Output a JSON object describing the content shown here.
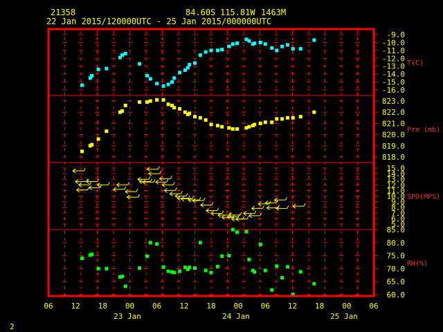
{
  "header": {
    "station": "21358",
    "lat": "84.60S",
    "lon": "115.81W",
    "elev": "1463M",
    "range": "22 Jan 2015/120000UTC - 25 Jan 2015/000000UTC"
  },
  "footer": {
    "page_num": "2"
  },
  "colors": {
    "frame": "#ff0000",
    "text": "#ffff00",
    "temp": "#00ffff",
    "pres": "#ffff00",
    "wind": "#ffff00",
    "rh": "#00ff00"
  },
  "x_axis": {
    "hour_labels": [
      "06",
      "12",
      "18",
      "00",
      "06",
      "12",
      "18",
      "00",
      "06",
      "12",
      "18",
      "00",
      "06"
    ],
    "day_labels": [
      "23 Jan",
      "24 Jan",
      "25 Jan"
    ]
  },
  "chart_data": [
    {
      "type": "scatter",
      "name": "T(C)",
      "ylabel": "T(C)",
      "ylim": [
        -16,
        -9
      ],
      "ticks": [
        "-9.0",
        "-10.0",
        "-11.0",
        "-12.0",
        "-13.0",
        "-14.0",
        "-15.0",
        "-16.0"
      ],
      "x": [
        12.2,
        13.7,
        14.0,
        15.2,
        16.7,
        19.2,
        19.6,
        20.2,
        22.8,
        24.2,
        24.8,
        26.0,
        27.2,
        28.1,
        28.8,
        29.2,
        30.2,
        31.2,
        31.7,
        32.0,
        33.0,
        34.0,
        35.0,
        36.0,
        37.2,
        38.0,
        39.3,
        40.0,
        40.8,
        42.5,
        43.0,
        43.7,
        44.0,
        45.1,
        46.0,
        47.2,
        48.1,
        49.1,
        50.1,
        51.1,
        52.5,
        55.0
      ],
      "y": [
        -15.4,
        -14.5,
        -14.2,
        -13.4,
        -13.3,
        -11.9,
        -11.6,
        -11.4,
        -12.7,
        -14.2,
        -14.6,
        -15.2,
        -15.5,
        -15.3,
        -15.0,
        -14.5,
        -13.8,
        -13.5,
        -13.2,
        -12.8,
        -12.6,
        -11.6,
        -11.2,
        -11.0,
        -11.0,
        -10.9,
        -10.5,
        -10.2,
        -10.1,
        -9.6,
        -9.8,
        -10.2,
        -10.1,
        -10.0,
        -10.2,
        -10.7,
        -11.0,
        -10.5,
        -10.3,
        -10.8,
        -10.8,
        -9.7
      ]
    },
    {
      "type": "scatter",
      "name": "Pre (mb)",
      "ylabel": "Pre (mb)",
      "ylim": [
        818,
        823
      ],
      "ticks": [
        "823.0",
        "822.0",
        "821.0",
        "820.0",
        "819.0",
        "818.0"
      ],
      "x": [
        12.2,
        13.7,
        14.0,
        15.2,
        16.7,
        19.2,
        19.6,
        20.2,
        22.8,
        24.2,
        24.8,
        26.0,
        27.2,
        28.1,
        28.8,
        29.2,
        30.2,
        31.2,
        31.7,
        32.0,
        33.0,
        34.0,
        35.0,
        36.0,
        37.2,
        38.0,
        39.3,
        40.0,
        40.8,
        42.5,
        43.0,
        43.7,
        44.0,
        45.1,
        46.0,
        47.2,
        48.1,
        49.1,
        50.1,
        51.1,
        52.5,
        55.0
      ],
      "y": [
        818.5,
        819.0,
        819.1,
        819.6,
        820.3,
        822.0,
        822.1,
        822.6,
        822.9,
        822.9,
        823.0,
        823.1,
        823.1,
        822.7,
        822.6,
        822.4,
        822.3,
        822.0,
        821.8,
        821.9,
        821.6,
        821.5,
        821.3,
        820.9,
        820.8,
        820.7,
        820.6,
        820.5,
        820.5,
        820.6,
        820.7,
        820.8,
        820.9,
        821.0,
        821.1,
        821.1,
        821.4,
        821.4,
        821.5,
        821.5,
        821.6,
        822.0
      ]
    },
    {
      "type": "barbs",
      "name": "SPD(MPS)",
      "ylabel": "SPD(MPS)",
      "ylim": [
        5,
        15
      ],
      "ticks": [
        "15.0",
        "14.0",
        "13.0",
        "12.0",
        "11.0",
        "10.0",
        "9.0",
        "8.0",
        "7.0",
        "6.0",
        "5.0"
      ],
      "x": [
        11.5,
        12.0,
        12.2,
        12.6,
        14.0,
        14.5,
        16.0,
        19.0,
        19.6,
        21.2,
        21.5,
        23.5,
        23.8,
        24.4,
        25.2,
        25.5,
        26.8,
        27.5,
        28.0,
        28.4,
        29.4,
        30.4,
        30.8,
        31.5,
        32.8,
        33.6,
        35.1,
        36.1,
        37.0,
        38.3,
        39.0,
        40.0,
        40.3,
        40.8,
        41.6,
        43.0,
        44.0,
        44.5,
        45.7,
        47.0,
        47.3,
        48.7,
        49.0,
        52.1
      ],
      "y": [
        14.5,
        12.6,
        11.1,
        12.0,
        12.6,
        11.5,
        12.0,
        11.2,
        12.0,
        10.8,
        9.8,
        13.0,
        12.6,
        12.5,
        14.8,
        14.0,
        12.5,
        13.1,
        12.0,
        11.0,
        10.4,
        10.0,
        9.6,
        9.5,
        9.3,
        9.2,
        8.4,
        7.4,
        6.9,
        6.6,
        6.2,
        6.3,
        6.6,
        5.9,
        5.9,
        6.9,
        6.5,
        7.8,
        8.6,
        8.8,
        7.9,
        9.3,
        7.8,
        8.2
      ]
    },
    {
      "type": "scatter",
      "name": "RH(%)",
      "ylabel": "RH(%)",
      "ylim": [
        60,
        85
      ],
      "ticks": [
        "85.0",
        "80.0",
        "75.0",
        "70.0",
        "65.0",
        "60.0"
      ],
      "x": [
        12.2,
        13.7,
        14.0,
        15.2,
        16.7,
        19.2,
        19.6,
        20.2,
        22.8,
        24.2,
        24.8,
        26.0,
        27.2,
        28.1,
        28.8,
        29.2,
        30.2,
        31.2,
        31.7,
        32.0,
        33.0,
        34.0,
        35.0,
        36.0,
        37.2,
        38.0,
        39.3,
        40.0,
        40.8,
        42.5,
        43.0,
        43.7,
        44.0,
        45.1,
        46.0,
        47.2,
        48.1,
        49.1,
        50.1,
        51.1,
        52.5,
        55.0
      ],
      "y": [
        74.0,
        75.2,
        75.5,
        70.0,
        70.0,
        66.8,
        67.0,
        63.2,
        70.2,
        74.8,
        80.0,
        79.5,
        70.6,
        69.0,
        68.7,
        68.5,
        69.0,
        70.5,
        69.7,
        70.5,
        70.2,
        80.0,
        69.3,
        68.5,
        70.8,
        74.8,
        75.0,
        85.0,
        84.0,
        84.2,
        73.5,
        69.3,
        68.7,
        79.3,
        69.3,
        61.8,
        71.0,
        66.5,
        70.7,
        60.1,
        68.8,
        64.2
      ]
    }
  ]
}
